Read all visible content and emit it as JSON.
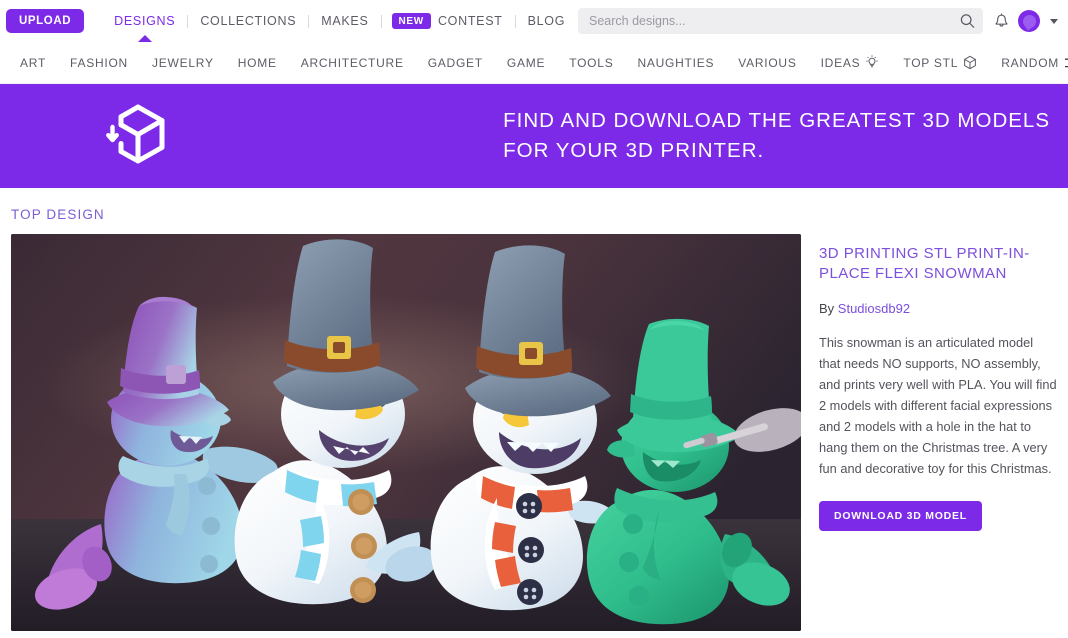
{
  "header": {
    "upload_label": "UPLOAD",
    "nav": [
      {
        "label": "DESIGNS",
        "active": true
      },
      {
        "label": "COLLECTIONS",
        "active": false
      },
      {
        "label": "MAKES",
        "active": false
      },
      {
        "label": "CONTEST",
        "active": false,
        "badge": "NEW"
      },
      {
        "label": "BLOG",
        "active": false
      }
    ],
    "search": {
      "placeholder": "Search designs...",
      "value": "",
      "icon": "search-icon"
    },
    "bell_icon": "notification-bell-icon",
    "avatar_icon": "user-avatar",
    "account_caret_icon": "chevron-down-icon"
  },
  "categories": [
    {
      "label": "ART",
      "icon": ""
    },
    {
      "label": "FASHION",
      "icon": ""
    },
    {
      "label": "JEWELRY",
      "icon": ""
    },
    {
      "label": "HOME",
      "icon": ""
    },
    {
      "label": "ARCHITECTURE",
      "icon": ""
    },
    {
      "label": "GADGET",
      "icon": ""
    },
    {
      "label": "GAME",
      "icon": ""
    },
    {
      "label": "TOOLS",
      "icon": ""
    },
    {
      "label": "NAUGHTIES",
      "icon": ""
    },
    {
      "label": "VARIOUS",
      "icon": ""
    },
    {
      "label": "IDEAS",
      "icon": "lightbulb-icon"
    },
    {
      "label": "TOP STL",
      "icon": "cube-icon"
    },
    {
      "label": "RANDOM",
      "icon": "shuffle-icon"
    }
  ],
  "hero": {
    "logo_icon": "cube-download-icon",
    "headline_line1": "FIND AND DOWNLOAD THE GREATEST 3D MODELS",
    "headline_line2": "FOR YOUR 3D PRINTER."
  },
  "main": {
    "section_label": "TOP DESIGN",
    "design": {
      "image_alt": "Four 3D printed flexi snowman figurines with top hats and scarves",
      "title": "3D PRINTING STL PRINT-IN-PLACE FLEXI SNOWMAN",
      "by_prefix": "By ",
      "author": "Studiosdb92",
      "description": "This snowman is an articulated model that needs NO supports, NO assembly, and prints very well with PLA. You will find 2 models with different facial expressions and 2 models with a hole in the hat to hang them on the Christmas tree. A very fun and decorative toy for this Christmas.",
      "download_label": "DOWNLOAD 3D MODEL"
    }
  },
  "colors": {
    "brand_purple": "#7c2ae8",
    "link_purple": "#7c4fdc",
    "section_purple": "#7c5fd3",
    "text_gray": "#53535c",
    "nav_gray": "#5c5c66",
    "search_bg": "#eeeef1"
  }
}
